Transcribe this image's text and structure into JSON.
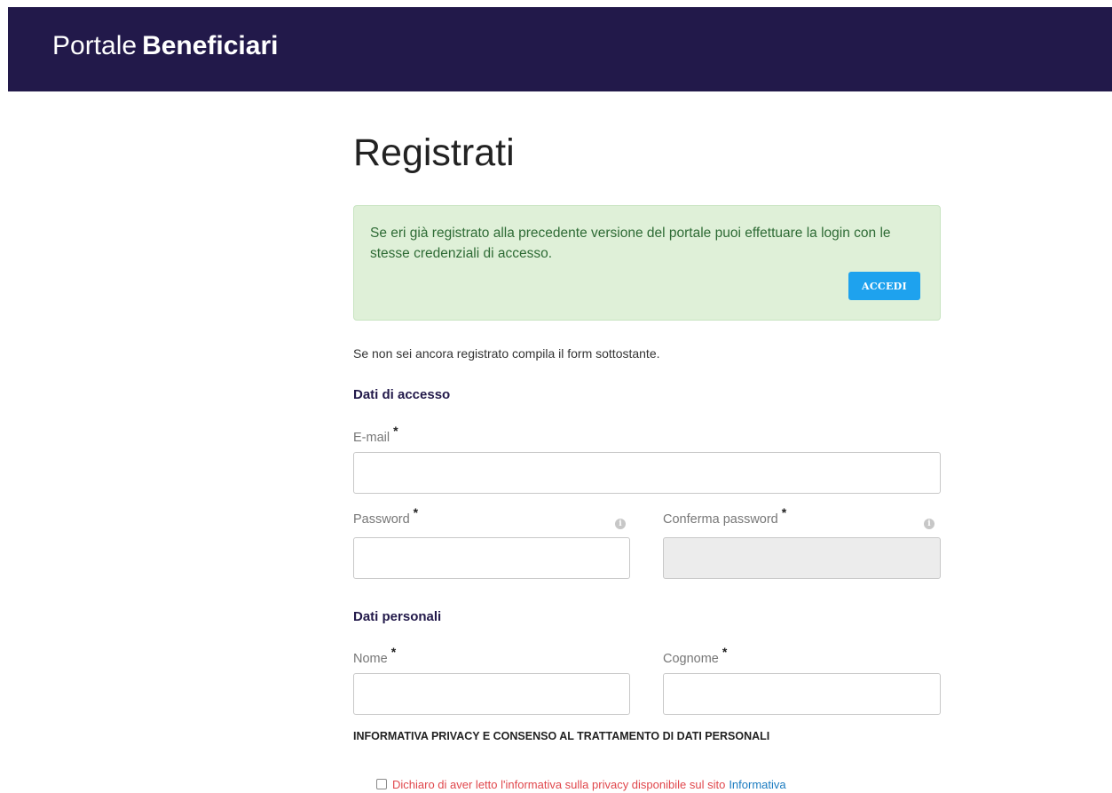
{
  "header": {
    "brand_light": "Portale",
    "brand_bold": "Beneficiari"
  },
  "page": {
    "title": "Registrati"
  },
  "alert": {
    "text": "Se eri già registrato alla precedente versione del portale puoi effettuare la login con le stesse credenziali di accesso.",
    "button_label": "ACCEDI"
  },
  "intro_text": "Se non sei ancora registrato compila il form sottostante.",
  "access_section": {
    "heading": "Dati di accesso",
    "email_label": "E-mail",
    "email_value": "",
    "password_label": "Password",
    "password_value": "",
    "confirm_password_label": "Conferma password",
    "confirm_password_value": "",
    "required_marker": "*",
    "info_icon": "info-circle-icon"
  },
  "personal_section": {
    "heading": "Dati personali",
    "name_label": "Nome",
    "name_value": "",
    "surname_label": "Cognome",
    "surname_value": "",
    "required_marker": "*"
  },
  "privacy": {
    "heading": "INFORMATIVA PRIVACY E CONSENSO AL TRATTAMENTO DI DATI PERSONALI",
    "consent_text": "Dichiaro di aver letto l'informativa sulla privacy disponibile sul sito",
    "consent_link": "Informativa",
    "checked": false
  },
  "colors": {
    "header_bg": "#22194a",
    "alert_bg": "#dff0d8",
    "alert_text": "#2e6b35",
    "button_bg": "#1ea2ee",
    "required_error": "#e0474c",
    "link": "#1a7bc0"
  }
}
